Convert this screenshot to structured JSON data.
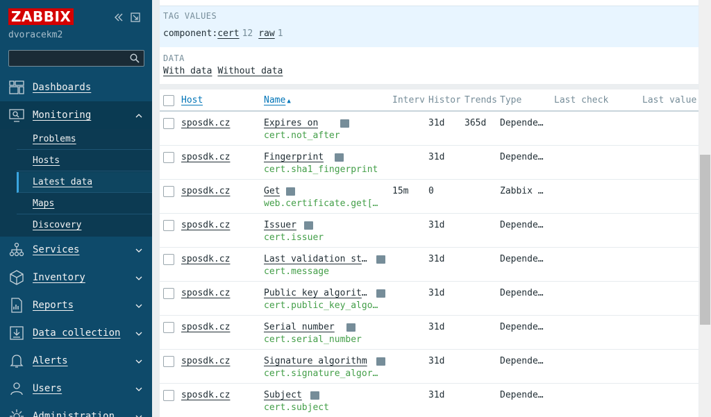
{
  "sidebar": {
    "logo": "ZABBIX",
    "user": "dvoracekm2",
    "search_value": "",
    "menu": [
      {
        "label": "Dashboards",
        "icon": "dashboards-icon"
      },
      {
        "label": "Monitoring",
        "icon": "monitoring-icon"
      },
      {
        "label": "Services",
        "icon": "services-icon"
      },
      {
        "label": "Inventory",
        "icon": "inventory-icon"
      },
      {
        "label": "Reports",
        "icon": "reports-icon"
      },
      {
        "label": "Data collection",
        "icon": "data-collection-icon"
      },
      {
        "label": "Alerts",
        "icon": "alerts-icon"
      },
      {
        "label": "Users",
        "icon": "users-icon"
      },
      {
        "label": "Administration",
        "icon": "administration-icon"
      }
    ],
    "submenu": [
      "Problems",
      "Hosts",
      "Latest data",
      "Maps",
      "Discovery"
    ],
    "selected_submenu": "Latest data"
  },
  "filter": {
    "tag_values_label": "TAG VALUES",
    "tag_name": "component:",
    "tag_values": [
      {
        "value": "cert",
        "count": "12"
      },
      {
        "value": "raw",
        "count": "1"
      }
    ],
    "data_label": "DATA",
    "data_links": [
      "With data",
      "Without data"
    ]
  },
  "table": {
    "columns": {
      "host": "Host",
      "name": "Name",
      "name_sort": "▲",
      "interval": "Interval",
      "history": "History",
      "trends": "Trends",
      "type": "Type",
      "last_check": "Last check",
      "last_value": "Last value"
    },
    "rows": [
      {
        "host": "sposdk.cz",
        "name": "Expires on",
        "key": "cert.not_after",
        "interval": "",
        "history": "31d",
        "trends": "365d",
        "type": "Dependent item"
      },
      {
        "host": "sposdk.cz",
        "name": "Fingerprint",
        "key": "cert.sha1_fingerprint",
        "interval": "",
        "history": "31d",
        "trends": "",
        "type": "Dependent item"
      },
      {
        "host": "sposdk.cz",
        "name": "Get",
        "key": "web.certificate.get[…",
        "interval": "15m",
        "history": "0",
        "trends": "",
        "type": "Zabbix agent"
      },
      {
        "host": "sposdk.cz",
        "name": "Issuer",
        "key": "cert.issuer",
        "interval": "",
        "history": "31d",
        "trends": "",
        "type": "Dependent item"
      },
      {
        "host": "sposdk.cz",
        "name": "Last validation status",
        "key": "cert.message",
        "interval": "",
        "history": "31d",
        "trends": "",
        "type": "Dependent item"
      },
      {
        "host": "sposdk.cz",
        "name": "Public key algorithm",
        "key": "cert.public_key_algo…",
        "interval": "",
        "history": "31d",
        "trends": "",
        "type": "Dependent item"
      },
      {
        "host": "sposdk.cz",
        "name": "Serial number",
        "key": "cert.serial_number",
        "interval": "",
        "history": "31d",
        "trends": "",
        "type": "Dependent item"
      },
      {
        "host": "sposdk.cz",
        "name": "Signature algorithm",
        "key": "cert.signature_algor…",
        "interval": "",
        "history": "31d",
        "trends": "",
        "type": "Dependent item"
      },
      {
        "host": "sposdk.cz",
        "name": "Subject",
        "key": "cert.subject",
        "interval": "",
        "history": "31d",
        "trends": "",
        "type": "Dependent item"
      }
    ]
  }
}
